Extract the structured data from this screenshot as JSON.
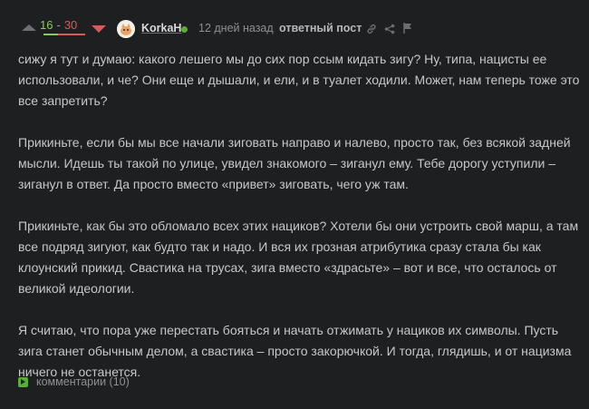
{
  "header": {
    "score_positive": "16",
    "score_separator": "-",
    "score_negative": "30",
    "username": "KorkaH",
    "time": "12 дней назад",
    "post_type": "ответный пост",
    "rating_fraction_positive": 0.35
  },
  "post": {
    "paragraphs": [
      "сижу я тут и думаю: какого лешего мы до сих пор ссым кидать зигу? Ну, типа, нацисты ее использовали, и че? Они еще и дышали, и ели, и в туалет ходили. Может, нам теперь тоже это все запретить?",
      "Прикиньте, если бы мы все начали зиговать направо и налево, просто так, без всякой задней мысли. Идешь ты такой по улице, увидел знакомого – зиганул ему. Тебе дорогу уступили – зиганул в ответ. Да просто вместо «привет» зиговать, чего уж там.",
      "Прикиньте, как бы это обломало всех этих нациков? Хотели бы они устроить свой марш, а там все подряд зигуют, как будто так и надо. И вся их грозная атрибутика сразу стала бы как  клоунский прикид. Свастика на трусах, зига вместо «здрасьте» – вот и все, что осталось от великой идеологии.",
      "Я считаю, что пора уже перестать бояться и начать отжимать у нациков их символы. Пусть зига станет обычным делом, а свастика – просто закорючкой. И тогда, глядишь, и от нацизма ничего не останется."
    ]
  },
  "footer": {
    "comments_label": "комментарии (10)"
  },
  "colors": {
    "background": "#1e1f21",
    "positive": "#8ac858",
    "negative": "#d35b5b",
    "online": "#5dab3a"
  },
  "icons": [
    "arrow-up-icon",
    "arrow-down-icon",
    "link-icon",
    "share-icon",
    "flag-icon",
    "comment-icon"
  ]
}
